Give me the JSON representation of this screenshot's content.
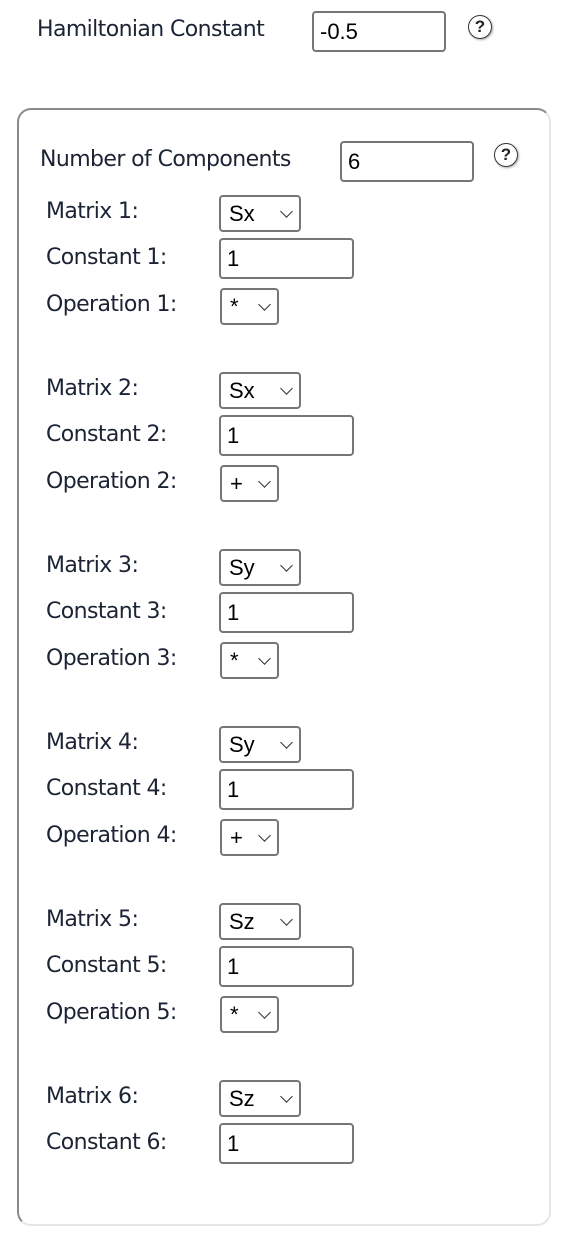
{
  "hamiltonian": {
    "label": "Hamiltonian Constant",
    "value": "-0.5",
    "help": "?"
  },
  "components": {
    "label": "Number of Components",
    "value": "6",
    "help": "?",
    "items": [
      {
        "matrix_label": "Matrix 1:",
        "matrix": "Sx",
        "constant_label": "Constant 1:",
        "constant": "1",
        "operation_label": "Operation 1:",
        "operation": "*"
      },
      {
        "matrix_label": "Matrix 2:",
        "matrix": "Sx",
        "constant_label": "Constant 2:",
        "constant": "1",
        "operation_label": "Operation 2:",
        "operation": "+"
      },
      {
        "matrix_label": "Matrix 3:",
        "matrix": "Sy",
        "constant_label": "Constant 3:",
        "constant": "1",
        "operation_label": "Operation 3:",
        "operation": "*"
      },
      {
        "matrix_label": "Matrix 4:",
        "matrix": "Sy",
        "constant_label": "Constant 4:",
        "constant": "1",
        "operation_label": "Operation 4:",
        "operation": "+"
      },
      {
        "matrix_label": "Matrix 5:",
        "matrix": "Sz",
        "constant_label": "Constant 5:",
        "constant": "1",
        "operation_label": "Operation 5:",
        "operation": "*"
      },
      {
        "matrix_label": "Matrix 6:",
        "matrix": "Sz",
        "constant_label": "Constant 6:",
        "constant": "1"
      }
    ]
  }
}
